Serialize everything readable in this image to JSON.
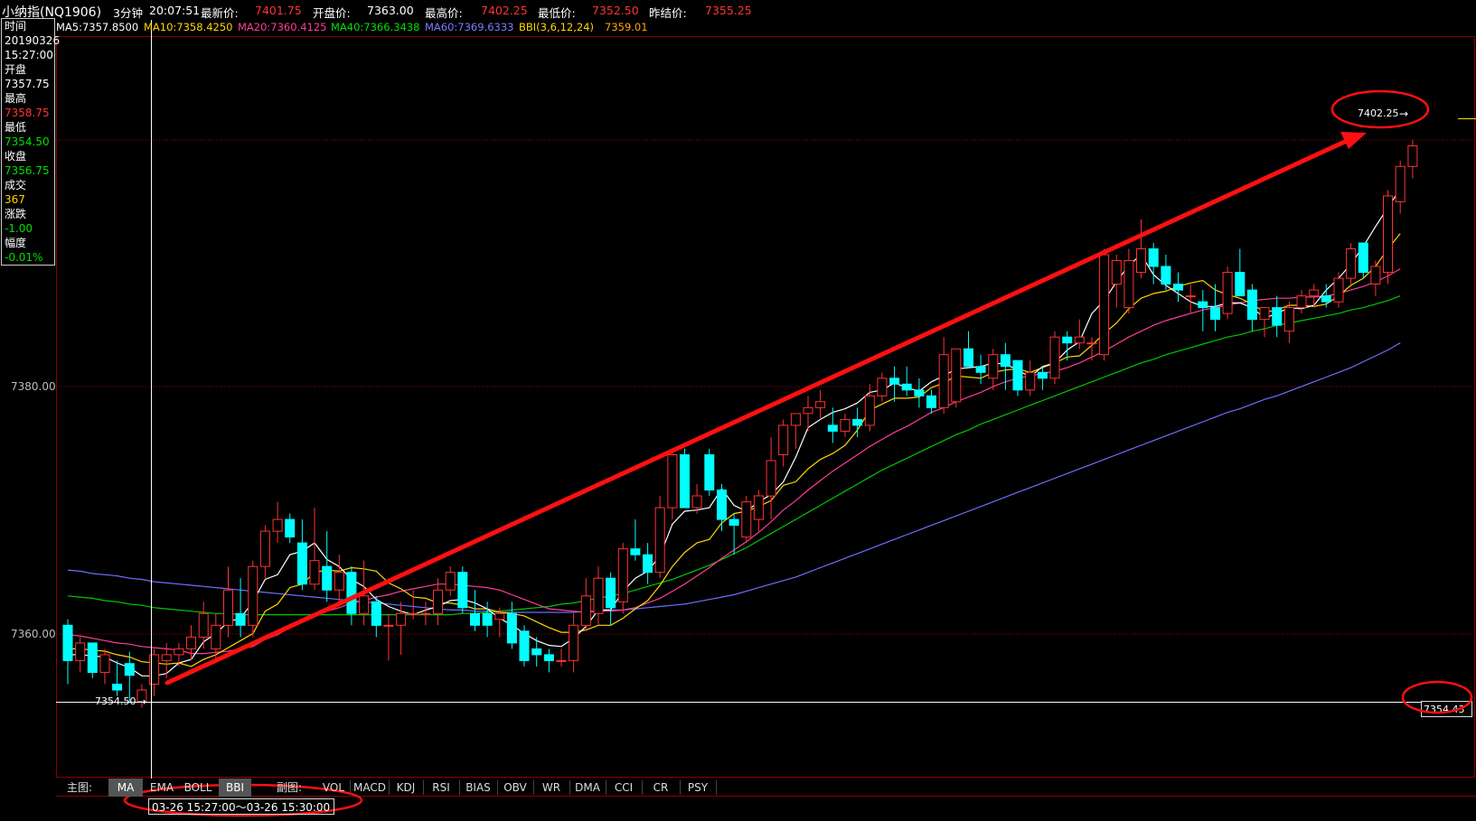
{
  "header": {
    "symbol": "小纳指(NQ1906)",
    "period": "3分钟",
    "time": "20:07:51",
    "last_label": "最新价:",
    "last_value": "7401.75",
    "open_label": "开盘价:",
    "open_value": "7363.00",
    "high_label": "最高价:",
    "high_value": "7402.25",
    "low_label": "最低价:",
    "low_value": "7352.50",
    "prev_label": "昨结价:",
    "prev_value": "7355.25"
  },
  "ma_bar": [
    {
      "text": "MA5:7357.8500",
      "color": "#ffffff"
    },
    {
      "text": "MA10:7358.4250",
      "color": "#ffd700"
    },
    {
      "text": "MA20:7360.4125",
      "color": "#ff3c9b"
    },
    {
      "text": "MA40:7366.3438",
      "color": "#00e000"
    },
    {
      "text": "MA60:7369.6333",
      "color": "#7b7bff"
    },
    {
      "text": "BBI(3,6,12,24)",
      "color": "#ffd700"
    },
    {
      "text": "7359.01",
      "color": "#ffa500"
    }
  ],
  "info": {
    "time_label": "时间",
    "date": "20190326",
    "time": "15:27:00",
    "open_label": "开盘",
    "open": "7357.75",
    "high_label": "最高",
    "high": "7358.75",
    "low_label": "最低",
    "low": "7354.50",
    "close_label": "收盘",
    "close": "7356.75",
    "vol_label": "成交",
    "vol": "367",
    "chg_label": "涨跌",
    "chg": "-1.00",
    "pct_label": "幅度",
    "pct": "-0.01%"
  },
  "axis": {
    "label_upper": "7380.00",
    "label_lower": "7360.00",
    "crosshair_label": "7354.50",
    "high_marker": "7402.25",
    "right_price": "7354.43"
  },
  "bottom": {
    "main_label": "主图:",
    "main_tabs": [
      "MA",
      "EMA",
      "BOLL",
      "BBI"
    ],
    "main_selected": [
      0,
      3
    ],
    "sub_label": "副图:",
    "sub_tabs": [
      "VOL",
      "MACD",
      "KDJ",
      "RSI",
      "BIAS",
      "OBV",
      "WR",
      "DMA",
      "CCI",
      "CR",
      "PSY"
    ],
    "time_range": "03-26 15:27:00～03-26 15:30:00"
  },
  "colors": {
    "up": "#ff3232",
    "down": "#00ffff",
    "ma5": "#ffffff",
    "ma10": "#ffd700",
    "ma20": "#ff3c9b",
    "ma40": "#00c800",
    "ma60": "#6e6eff",
    "annotation": "#ff1010"
  },
  "chart_data": {
    "type": "candlestick",
    "ylim": [
      7353.0,
      7405.0
    ],
    "ohlc": [
      [
        7361.0,
        7361.5,
        7356.0,
        7358.0
      ],
      [
        7358.0,
        7360.0,
        7357.0,
        7359.5
      ],
      [
        7359.5,
        7359.5,
        7356.5,
        7357.0
      ],
      [
        7357.0,
        7359.0,
        7356.0,
        7358.5
      ],
      [
        7356.0,
        7358.0,
        7355.0,
        7355.5
      ],
      [
        7357.75,
        7358.75,
        7354.5,
        7356.75
      ],
      [
        7354.5,
        7356.0,
        7354.0,
        7355.5
      ],
      [
        7356.0,
        7359.0,
        7355.0,
        7358.5
      ],
      [
        7358.0,
        7359.5,
        7356.5,
        7358.5
      ],
      [
        7358.5,
        7359.5,
        7357.5,
        7359.0
      ],
      [
        7359.0,
        7361.0,
        7358.0,
        7360.0
      ],
      [
        7360.0,
        7363.0,
        7359.0,
        7362.0
      ],
      [
        7359.0,
        7362.0,
        7358.0,
        7361.0
      ],
      [
        7361.0,
        7366.0,
        7360.0,
        7364.0
      ],
      [
        7362.0,
        7365.0,
        7360.0,
        7361.0
      ],
      [
        7361.0,
        7366.5,
        7360.0,
        7366.0
      ],
      [
        7366.0,
        7369.5,
        7365.0,
        7369.0
      ],
      [
        7369.0,
        7371.5,
        7368.0,
        7370.0
      ],
      [
        7370.0,
        7370.5,
        7368.0,
        7368.5
      ],
      [
        7368.0,
        7370.0,
        7364.0,
        7364.5
      ],
      [
        7364.5,
        7371.0,
        7364.0,
        7366.5
      ],
      [
        7366.0,
        7369.0,
        7363.0,
        7364.0
      ],
      [
        7364.0,
        7367.0,
        7363.0,
        7365.5
      ],
      [
        7365.5,
        7366.0,
        7361.0,
        7362.0
      ],
      [
        7362.0,
        7366.5,
        7361.0,
        7363.5
      ],
      [
        7363.0,
        7363.5,
        7360.0,
        7361.0
      ],
      [
        7361.0,
        7362.0,
        7358.0,
        7361.0
      ],
      [
        7361.0,
        7363.0,
        7358.5,
        7362.0
      ],
      [
        7362.0,
        7364.0,
        7361.5,
        7362.0
      ],
      [
        7362.0,
        7363.0,
        7361.0,
        7362.0
      ],
      [
        7362.0,
        7365.0,
        7361.0,
        7364.0
      ],
      [
        7364.0,
        7366.0,
        7363.5,
        7365.5
      ],
      [
        7365.5,
        7366.0,
        7362.0,
        7362.5
      ],
      [
        7362.0,
        7364.0,
        7360.5,
        7361.0
      ],
      [
        7362.0,
        7363.0,
        7360.0,
        7361.0
      ],
      [
        7361.5,
        7362.5,
        7360.0,
        7362.0
      ],
      [
        7362.0,
        7363.0,
        7359.0,
        7359.5
      ],
      [
        7360.5,
        7361.0,
        7357.5,
        7358.0
      ],
      [
        7359.0,
        7360.0,
        7357.5,
        7358.5
      ],
      [
        7358.5,
        7359.0,
        7357.0,
        7358.0
      ],
      [
        7358.0,
        7359.0,
        7357.5,
        7358.0
      ],
      [
        7358.0,
        7362.0,
        7357.0,
        7361.0
      ],
      [
        7361.0,
        7365.0,
        7360.5,
        7363.5
      ],
      [
        7362.0,
        7366.0,
        7361.0,
        7365.0
      ],
      [
        7365.0,
        7365.5,
        7361.0,
        7362.5
      ],
      [
        7363.0,
        7368.0,
        7362.0,
        7367.5
      ],
      [
        7367.5,
        7370.0,
        7366.5,
        7367.0
      ],
      [
        7367.0,
        7368.0,
        7364.5,
        7365.5
      ],
      [
        7365.5,
        7372.0,
        7365.0,
        7371.0
      ],
      [
        7371.0,
        7376.0,
        7370.0,
        7375.5
      ],
      [
        7375.5,
        7376.0,
        7371.5,
        7371.0
      ],
      [
        7371.0,
        7373.0,
        7370.5,
        7372.0
      ],
      [
        7375.5,
        7376.0,
        7372.0,
        7372.5
      ],
      [
        7372.5,
        7373.0,
        7369.0,
        7370.0
      ],
      [
        7370.0,
        7370.5,
        7367.0,
        7369.5
      ],
      [
        7368.5,
        7372.0,
        7368.0,
        7371.5
      ],
      [
        7370.0,
        7372.5,
        7369.0,
        7372.0
      ],
      [
        7372.0,
        7377.0,
        7370.0,
        7375.0
      ],
      [
        7375.5,
        7378.5,
        7374.5,
        7378.0
      ],
      [
        7378.0,
        7379.0,
        7376.0,
        7379.0
      ],
      [
        7379.0,
        7380.5,
        7377.5,
        7379.5
      ],
      [
        7379.5,
        7381.0,
        7378.5,
        7380.0
      ],
      [
        7378.0,
        7379.5,
        7376.5,
        7377.5
      ],
      [
        7377.5,
        7379.0,
        7377.0,
        7378.5
      ],
      [
        7378.5,
        7379.5,
        7377.0,
        7378.0
      ],
      [
        7378.0,
        7381.5,
        7377.5,
        7380.5
      ],
      [
        7380.5,
        7382.5,
        7380.0,
        7382.0
      ],
      [
        7382.0,
        7383.0,
        7380.0,
        7381.5
      ],
      [
        7381.5,
        7383.0,
        7380.5,
        7381.0
      ],
      [
        7381.0,
        7382.0,
        7379.5,
        7380.5
      ],
      [
        7380.5,
        7381.0,
        7379.0,
        7379.5
      ],
      [
        7379.5,
        7385.5,
        7379.0,
        7384.0
      ],
      [
        7380.0,
        7384.0,
        7379.5,
        7384.5
      ],
      [
        7384.5,
        7386.0,
        7384.0,
        7383.0
      ],
      [
        7383.0,
        7384.0,
        7381.5,
        7382.5
      ],
      [
        7382.0,
        7384.5,
        7381.0,
        7384.0
      ],
      [
        7384.0,
        7385.0,
        7381.0,
        7383.0
      ],
      [
        7383.5,
        7383.5,
        7380.5,
        7381.0
      ],
      [
        7381.0,
        7383.5,
        7380.5,
        7382.5
      ],
      [
        7382.5,
        7383.0,
        7381.0,
        7382.0
      ],
      [
        7382.0,
        7386.0,
        7381.5,
        7385.5
      ],
      [
        7385.5,
        7386.0,
        7383.5,
        7385.0
      ],
      [
        7385.0,
        7387.0,
        7384.5,
        7385.5
      ],
      [
        7385.0,
        7385.5,
        7383.5,
        7385.0
      ],
      [
        7384.0,
        7393.0,
        7383.5,
        7392.5
      ],
      [
        7390.0,
        7392.5,
        7388.0,
        7392.0
      ],
      [
        7388.0,
        7393.0,
        7387.5,
        7392.0
      ],
      [
        7391.0,
        7395.5,
        7390.5,
        7393.0
      ],
      [
        7393.0,
        7393.5,
        7390.0,
        7391.5
      ],
      [
        7391.5,
        7392.5,
        7389.5,
        7390.0
      ],
      [
        7390.0,
        7391.0,
        7388.5,
        7389.5
      ],
      [
        7389.0,
        7390.0,
        7387.5,
        7389.0
      ],
      [
        7388.5,
        7389.5,
        7386.0,
        7388.0
      ],
      [
        7388.0,
        7390.0,
        7386.0,
        7387.0
      ],
      [
        7387.5,
        7391.5,
        7387.0,
        7391.0
      ],
      [
        7391.0,
        7393.0,
        7390.5,
        7389.0
      ],
      [
        7389.5,
        7390.0,
        7386.0,
        7387.0
      ],
      [
        7387.0,
        7388.0,
        7385.5,
        7388.0
      ],
      [
        7388.0,
        7389.0,
        7385.5,
        7386.5
      ],
      [
        7386.0,
        7388.5,
        7385.0,
        7388.0
      ],
      [
        7388.0,
        7389.5,
        7387.5,
        7389.0
      ],
      [
        7389.0,
        7390.0,
        7388.0,
        7389.5
      ],
      [
        7389.0,
        7390.0,
        7388.0,
        7388.5
      ],
      [
        7388.5,
        7391.0,
        7388.0,
        7390.5
      ],
      [
        7390.5,
        7393.5,
        7390.0,
        7393.0
      ],
      [
        7393.5,
        7393.5,
        7390.5,
        7391.0
      ],
      [
        7390.0,
        7392.0,
        7389.0,
        7391.5
      ],
      [
        7391.0,
        7398.0,
        7390.0,
        7397.5
      ],
      [
        7397.0,
        7400.5,
        7396.0,
        7400.0
      ],
      [
        7400.0,
        7402.25,
        7399.0,
        7401.75
      ]
    ],
    "ma_lines": {
      "MA5": [
        7358.5,
        7358.5,
        7358.4,
        7358.3,
        7357.8,
        7357.4,
        7356.7,
        7356.7,
        7356.9,
        7357.8,
        7358.1,
        7359.6,
        7360.3,
        7361.3,
        7361.6,
        7363.0,
        7364.9,
        7365.3,
        7367.0,
        7367.3,
        7368.0,
        7366.6,
        7366.0,
        7364.9,
        7364.3,
        7363.2,
        7362.6,
        7362.2,
        7361.9,
        7362.3,
        7362.6,
        7363.1,
        7363.2,
        7362.9,
        7362.4,
        7361.6,
        7361.0,
        7360.3,
        7359.7,
        7359.3,
        7359.2,
        7359.9,
        7360.9,
        7362.3,
        7362.3,
        7363.9,
        7365.0,
        7365.6,
        7366.9,
        7369.6,
        7370.7,
        7370.8,
        7371.0,
        7372.6,
        7371.2,
        7370.7,
        7371.5,
        7372.1,
        7373.2,
        7375.3,
        7377.8,
        7378.5,
        7379.1,
        7379.4,
        7379.9,
        7380.8,
        7381.0,
        7381.6,
        7381.2,
        7380.9,
        7381.7,
        7382.2,
        7382.8,
        7382.9,
        7383.0,
        7383.3,
        7383.2,
        7382.7,
        7382.1,
        7383.0,
        7383.3,
        7384.4,
        7385.1,
        7387.5,
        7388.6,
        7390.2,
        7391.6,
        7392.5,
        7390.8,
        7389.9,
        7389.2,
        7388.5,
        7388.1,
        7388.1,
        7388.4,
        7388.4,
        7388.0,
        7387.1,
        7387.5,
        7388.0,
        7387.9,
        7388.2,
        7389.5,
        7390.5,
        7391.7,
        7393.2,
        7394.9,
        7396.5,
        7398.1
      ],
      "MA10": [
        7359.0,
        7359.0,
        7358.9,
        7358.8,
        7358.5,
        7358.3,
        7357.9,
        7357.8,
        7357.7,
        7357.8,
        7357.5,
        7358.1,
        7358.5,
        7359.1,
        7359.7,
        7360.3,
        7362.2,
        7362.8,
        7364.2,
        7364.5,
        7365.5,
        7365.7,
        7365.6,
        7365.9,
        7365.8,
        7365.6,
        7364.6,
        7364.1,
        7363.4,
        7363.3,
        7362.9,
        7362.9,
        7362.7,
        7362.4,
        7362.4,
        7362.1,
        7362.0,
        7361.8,
        7361.3,
        7360.8,
        7360.4,
        7360.4,
        7360.6,
        7361.0,
        7361.0,
        7361.6,
        7362.4,
        7363.1,
        7364.4,
        7366.0,
        7367.2,
        7368.0,
        7368.3,
        7369.7,
        7370.5,
        7370.7,
        7371.1,
        7371.6,
        7372.9,
        7373.2,
        7374.3,
        7375.1,
        7375.6,
        7376.3,
        7377.6,
        7379.3,
        7379.8,
        7380.3,
        7380.3,
        7380.4,
        7381.2,
        7381.6,
        7382.2,
        7382.1,
        7382.0,
        7382.5,
        7382.7,
        7382.8,
        7382.5,
        7382.9,
        7383.3,
        7383.8,
        7383.9,
        7384.8,
        7385.8,
        7386.7,
        7387.9,
        7388.8,
        7389.2,
        7389.4,
        7389.8,
        7390.1,
        7390.3,
        7389.5,
        7389.1,
        7388.8,
        7388.3,
        7387.6,
        7387.8,
        7388.2,
        7388.2,
        7388.1,
        7388.3,
        7389.0,
        7389.9,
        7390.5,
        7391.5,
        7393.0,
        7394.3
      ],
      "MA20": [
        7360.2,
        7360.1,
        7359.9,
        7359.7,
        7359.5,
        7359.4,
        7359.2,
        7359.1,
        7359.0,
        7358.9,
        7358.6,
        7358.6,
        7358.7,
        7358.8,
        7359.0,
        7359.2,
        7359.8,
        7360.2,
        7360.8,
        7361.3,
        7361.8,
        7362.2,
        7362.5,
        7362.9,
        7363.1,
        7363.4,
        7363.6,
        7363.9,
        7364.1,
        7364.3,
        7364.5,
        7364.5,
        7364.4,
        7364.3,
        7364.2,
        7364.0,
        7363.6,
        7363.2,
        7362.8,
        7362.4,
        7362.3,
        7362.2,
        7362.1,
        7362.2,
        7362.2,
        7362.3,
        7362.5,
        7362.9,
        7363.3,
        7363.9,
        7364.5,
        7365.2,
        7365.9,
        7366.7,
        7367.4,
        7368.1,
        7368.9,
        7369.8,
        7370.8,
        7371.6,
        7372.5,
        7373.3,
        7374.1,
        7374.8,
        7375.5,
        7376.2,
        7376.8,
        7377.4,
        7377.9,
        7378.5,
        7379.1,
        7379.5,
        7380.0,
        7380.4,
        7380.8,
        7381.3,
        7381.7,
        7382.0,
        7382.2,
        7382.4,
        7382.6,
        7382.9,
        7383.3,
        7383.8,
        7384.3,
        7384.9,
        7385.5,
        7386.0,
        7386.5,
        7386.9,
        7387.2,
        7387.5,
        7387.8,
        7388.0,
        7388.2,
        7388.4,
        7388.6,
        7388.7,
        7388.8,
        7388.8,
        7388.9,
        7388.9,
        7389.0,
        7389.2,
        7389.5,
        7389.8,
        7390.2,
        7390.7,
        7391.3
      ],
      "MA40": [
        7363.5,
        7363.4,
        7363.3,
        7363.1,
        7363.0,
        7362.8,
        7362.7,
        7362.5,
        7362.4,
        7362.3,
        7362.2,
        7362.1,
        7362.0,
        7362.0,
        7361.9,
        7361.9,
        7361.9,
        7361.9,
        7361.9,
        7361.9,
        7361.9,
        7361.9,
        7361.9,
        7361.9,
        7361.9,
        7361.9,
        7361.9,
        7361.9,
        7361.9,
        7361.9,
        7361.9,
        7361.9,
        7362.0,
        7362.0,
        7362.1,
        7362.2,
        7362.3,
        7362.4,
        7362.5,
        7362.6,
        7362.8,
        7362.9,
        7363.1,
        7363.3,
        7363.5,
        7363.7,
        7364.0,
        7364.3,
        7364.6,
        7364.9,
        7365.3,
        7365.7,
        7366.1,
        7366.6,
        7367.1,
        7367.6,
        7368.2,
        7368.8,
        7369.4,
        7370.0,
        7370.6,
        7371.2,
        7371.8,
        7372.4,
        7373.0,
        7373.6,
        7374.2,
        7374.7,
        7375.2,
        7375.7,
        7376.2,
        7376.7,
        7377.2,
        7377.6,
        7378.1,
        7378.5,
        7378.9,
        7379.3,
        7379.7,
        7380.1,
        7380.5,
        7380.9,
        7381.3,
        7381.7,
        7382.1,
        7382.5,
        7382.9,
        7383.3,
        7383.6,
        7384.0,
        7384.3,
        7384.6,
        7384.9,
        7385.2,
        7385.5,
        7385.7,
        7386.0,
        7386.2,
        7386.5,
        7386.7,
        7386.9,
        7387.1,
        7387.3,
        7387.5,
        7387.8,
        7388.0,
        7388.3,
        7388.6,
        7389.0
      ],
      "MA60": [
        7365.7,
        7365.6,
        7365.4,
        7365.3,
        7365.2,
        7365.0,
        7364.9,
        7364.7,
        7364.6,
        7364.5,
        7364.4,
        7364.3,
        7364.2,
        7364.1,
        7364.0,
        7363.9,
        7363.8,
        7363.7,
        7363.6,
        7363.5,
        7363.4,
        7363.3,
        7363.2,
        7363.1,
        7363.0,
        7362.9,
        7362.8,
        7362.7,
        7362.6,
        7362.5,
        7362.4,
        7362.3,
        7362.3,
        7362.2,
        7362.2,
        7362.1,
        7362.1,
        7362.1,
        7362.1,
        7362.1,
        7362.1,
        7362.1,
        7362.2,
        7362.2,
        7362.3,
        7362.3,
        7362.4,
        7362.5,
        7362.6,
        7362.7,
        7362.8,
        7363.0,
        7363.2,
        7363.4,
        7363.6,
        7363.9,
        7364.2,
        7364.5,
        7364.8,
        7365.1,
        7365.5,
        7365.9,
        7366.3,
        7366.7,
        7367.1,
        7367.5,
        7367.9,
        7368.3,
        7368.7,
        7369.1,
        7369.5,
        7369.9,
        7370.3,
        7370.7,
        7371.1,
        7371.5,
        7371.9,
        7372.3,
        7372.7,
        7373.1,
        7373.5,
        7373.9,
        7374.3,
        7374.7,
        7375.1,
        7375.5,
        7375.9,
        7376.3,
        7376.7,
        7377.1,
        7377.5,
        7377.9,
        7378.3,
        7378.7,
        7379.1,
        7379.4,
        7379.8,
        7380.2,
        7380.5,
        7380.9,
        7381.3,
        7381.7,
        7382.1,
        7382.5,
        7382.9,
        7383.4,
        7383.9,
        7384.4,
        7385.0
      ]
    }
  }
}
